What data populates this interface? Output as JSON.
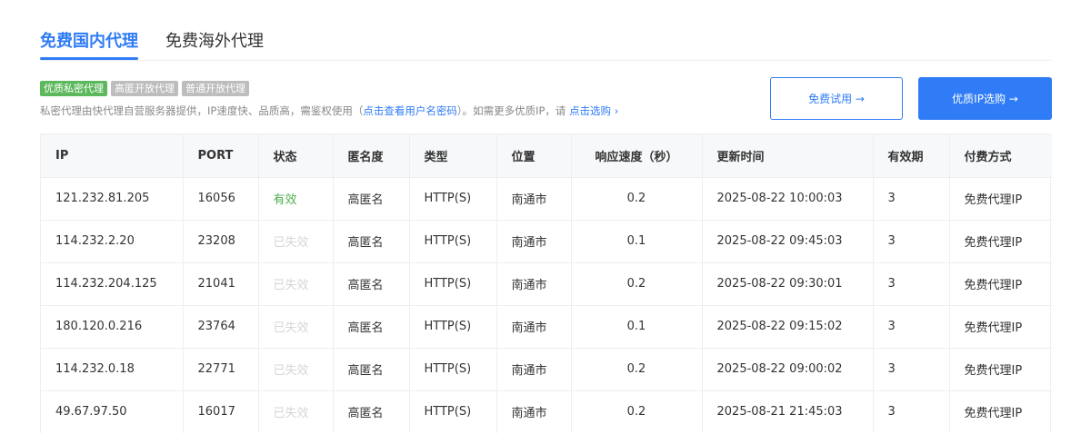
{
  "tabs": [
    "免费国内代理",
    "免费海外代理"
  ],
  "tags": [
    "优质私密代理",
    "高匿开放代理",
    "普通开放代理"
  ],
  "desc": {
    "prefix": "私密代理由快代理自营服务器提供，IP速度快、品质高，需鉴权使用（",
    "link1": "点击查看用户名密码",
    "middle": "）。如需更多优质IP，请 ",
    "link2": "点击选购 ›"
  },
  "buttons": {
    "trial": "免费试用 →",
    "premium": "优质IP选购 →"
  },
  "colors": {
    "accent": "#2f7cf6",
    "tag_active": "#5cb85c",
    "tag_inactive": "#bdbdbd",
    "valid": "#4cae4c",
    "invalid": "#d6d6d6"
  },
  "table": {
    "headers": [
      "IP",
      "PORT",
      "状态",
      "匿名度",
      "类型",
      "位置",
      "响应速度（秒）",
      "更新时间",
      "有效期",
      "付费方式"
    ],
    "rows": [
      [
        "121.232.81.205",
        "16056",
        "有效",
        "高匿名",
        "HTTP(S)",
        "南通市",
        "0.2",
        "2025-08-22 10:00:03",
        "3",
        "免费代理IP"
      ],
      [
        "114.232.2.20",
        "23208",
        "已失效",
        "高匿名",
        "HTTP(S)",
        "南通市",
        "0.1",
        "2025-08-22 09:45:03",
        "3",
        "免费代理IP"
      ],
      [
        "114.232.204.125",
        "21041",
        "已失效",
        "高匿名",
        "HTTP(S)",
        "南通市",
        "0.2",
        "2025-08-22 09:30:01",
        "3",
        "免费代理IP"
      ],
      [
        "180.120.0.216",
        "23764",
        "已失效",
        "高匿名",
        "HTTP(S)",
        "南通市",
        "0.1",
        "2025-08-22 09:15:02",
        "3",
        "免费代理IP"
      ],
      [
        "114.232.0.18",
        "22771",
        "已失效",
        "高匿名",
        "HTTP(S)",
        "南通市",
        "0.2",
        "2025-08-22 09:00:02",
        "3",
        "免费代理IP"
      ],
      [
        "49.67.97.50",
        "16017",
        "已失效",
        "高匿名",
        "HTTP(S)",
        "南通市",
        "0.2",
        "2025-08-21 21:45:03",
        "3",
        "免费代理IP"
      ]
    ]
  }
}
